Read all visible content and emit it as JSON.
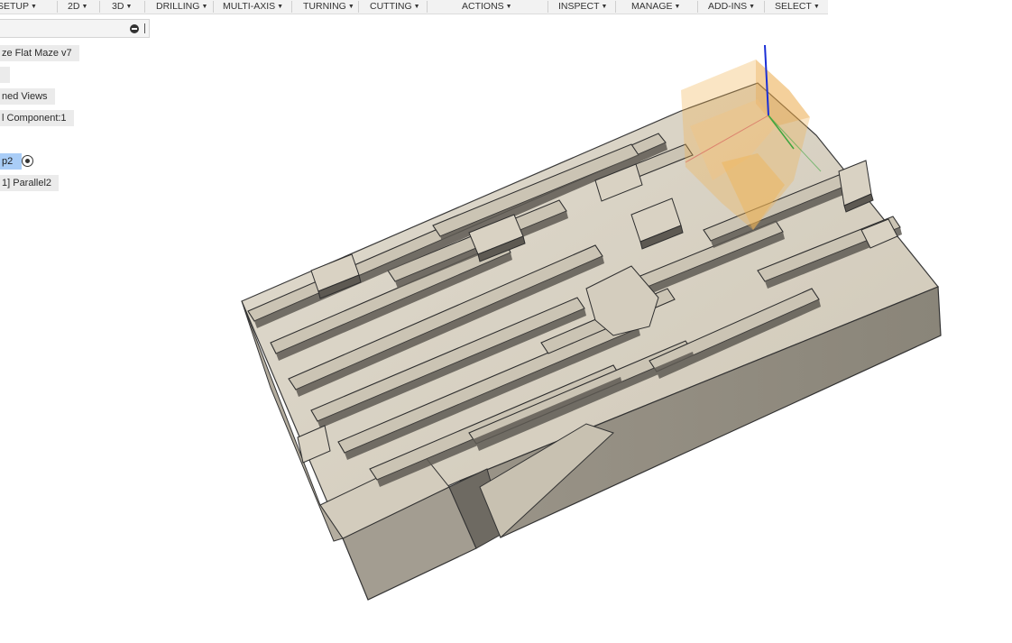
{
  "toolbar": {
    "setup": "SETUP",
    "d2": "2D",
    "d3": "3D",
    "drilling": "DRILLING",
    "multiaxis": "MULTI-AXIS",
    "turning": "TURNING",
    "cutting": "CUTTING",
    "actions": "ACTIONS",
    "inspect": "INSPECT",
    "manage": "MANAGE",
    "addins": "ADD-INS",
    "select": "SELECT"
  },
  "browser": {
    "search_value": "",
    "document": "ze Flat Maze v7",
    "named_views": "ned Views",
    "component": "l Component:1",
    "setup": "p2",
    "operation": "1] Parallel2"
  },
  "icons": {
    "caret": "caret-down-icon",
    "clear": "clear-search-icon",
    "target": "target-icon",
    "axes": "axes-triad-icon",
    "stock_box": "stock-box-icon"
  },
  "colors": {
    "selected_bg": "#a9cdf7",
    "stock_highlight": "#f0b455",
    "model_top": "#d6cfc0",
    "model_side": "#8c877c",
    "model_front": "#a49e92"
  }
}
